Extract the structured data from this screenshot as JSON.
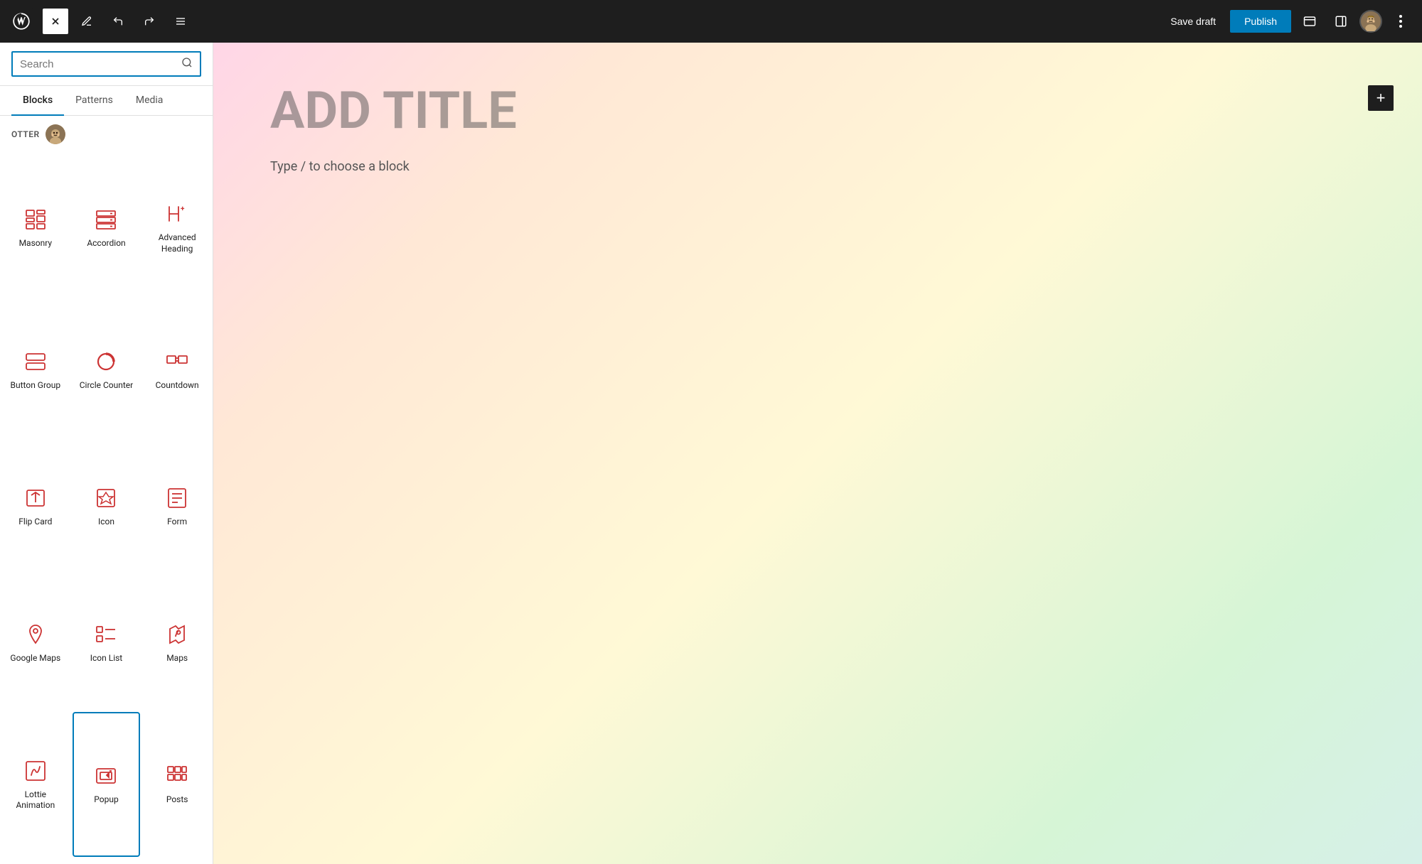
{
  "topbar": {
    "wp_logo_label": "WordPress",
    "close_label": "×",
    "save_draft_label": "Save draft",
    "publish_label": "Publish",
    "undo_label": "Undo",
    "redo_label": "Redo",
    "list_view_label": "List view",
    "panel_label": "Toggle panel",
    "more_label": "More options"
  },
  "sidebar": {
    "search": {
      "placeholder": "Search",
      "value": ""
    },
    "tabs": [
      {
        "id": "blocks",
        "label": "Blocks",
        "active": true
      },
      {
        "id": "patterns",
        "label": "Patterns",
        "active": false
      },
      {
        "id": "media",
        "label": "Media",
        "active": false
      }
    ],
    "otter_label": "OTTER",
    "blocks": [
      {
        "id": "masonry",
        "label": "Masonry",
        "icon": "masonry"
      },
      {
        "id": "accordion",
        "label": "Accordion",
        "icon": "accordion"
      },
      {
        "id": "advanced-heading",
        "label": "Advanced Heading",
        "icon": "advanced-heading"
      },
      {
        "id": "button-group",
        "label": "Button Group",
        "icon": "button-group"
      },
      {
        "id": "circle-counter",
        "label": "Circle Counter",
        "icon": "circle-counter"
      },
      {
        "id": "countdown",
        "label": "Countdown",
        "icon": "countdown"
      },
      {
        "id": "flip-card",
        "label": "Flip Card",
        "icon": "flip-card"
      },
      {
        "id": "icon",
        "label": "Icon",
        "icon": "icon"
      },
      {
        "id": "form",
        "label": "Form",
        "icon": "form"
      },
      {
        "id": "google-maps",
        "label": "Google Maps",
        "icon": "google-maps"
      },
      {
        "id": "icon-list",
        "label": "Icon List",
        "icon": "icon-list"
      },
      {
        "id": "maps",
        "label": "Maps",
        "icon": "maps"
      },
      {
        "id": "lottie-animation",
        "label": "Lottie Animation",
        "icon": "lottie-animation"
      },
      {
        "id": "popup",
        "label": "Popup",
        "icon": "popup",
        "selected": true
      },
      {
        "id": "posts",
        "label": "Posts",
        "icon": "posts"
      }
    ]
  },
  "canvas": {
    "page_title": "ADD TITLE",
    "page_hint": "Type / to choose a block",
    "add_block_label": "+"
  }
}
